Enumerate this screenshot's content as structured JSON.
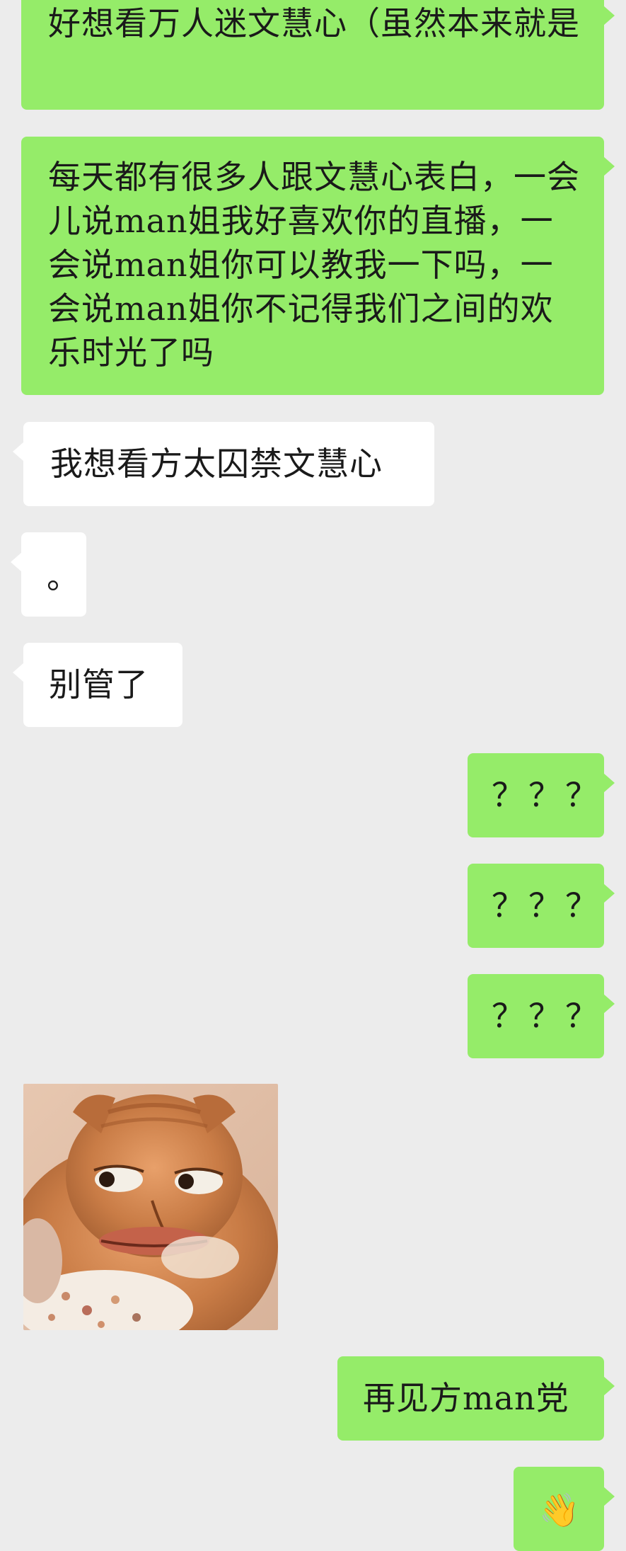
{
  "messages": [
    {
      "side": "out",
      "text": "好想看万人迷文慧心（虽然本来就是"
    },
    {
      "side": "out",
      "text": "每天都有很多人跟文慧心表白，一会儿说man姐我好喜欢你的直播，一会说man姐你可以教我一下吗，一会说man姐你不记得我们之间的欢乐时光了吗"
    },
    {
      "side": "in",
      "text": "我想看方太囚禁文慧心"
    },
    {
      "side": "in",
      "text": "。"
    },
    {
      "side": "in",
      "text": "别管了"
    },
    {
      "side": "out",
      "text": "？？？"
    },
    {
      "side": "out",
      "text": "？？？"
    },
    {
      "side": "out",
      "text": "？？？"
    },
    {
      "side": "in",
      "type": "image",
      "icon": "cat-meme-sticker"
    },
    {
      "side": "out",
      "text": "再见方man党"
    },
    {
      "side": "out",
      "emoji": "👋",
      "icon": "waving-hand-emoji"
    }
  ],
  "colors": {
    "background": "#ececec",
    "outgoing_bubble": "#95ec69",
    "incoming_bubble": "#ffffff"
  }
}
